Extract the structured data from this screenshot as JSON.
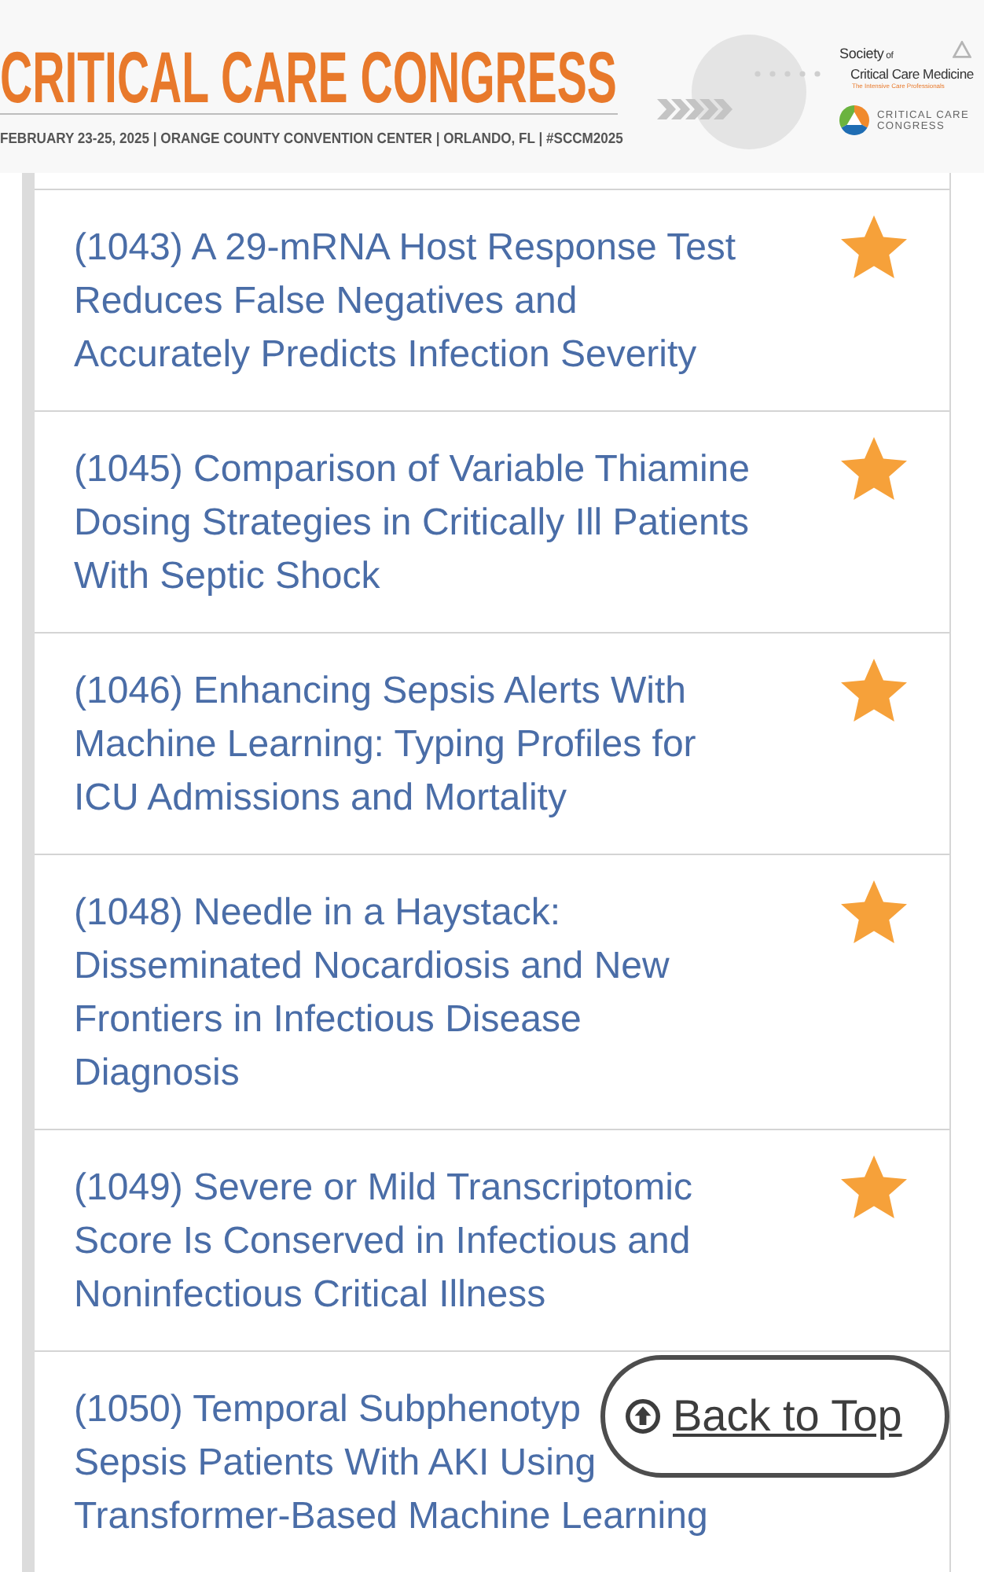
{
  "banner": {
    "title": "CRITICAL CARE CONGRESS",
    "subtitle": "FEBRUARY 23-25, 2025 | ORANGE COUNTY CONVENTION CENTER | ORLANDO, FL | #SCCM2025",
    "society_logo": {
      "line_1": "Society",
      "line_1_small": "of",
      "line_2": "Critical Care Medicine",
      "tagline": "The Intensive Care Professionals"
    },
    "congress_logo": {
      "line_1": "CRITICAL CARE",
      "line_2": "CONGRESS"
    }
  },
  "sessions": [
    {
      "title": "(1043) A 29-mRNA Host Response Test\nReduces False Negatives and\nAccurately Predicts Infection Severity",
      "starred": true
    },
    {
      "title": "(1045) Comparison of Variable Thiamine\nDosing Strategies in Critically Ill Patients\nWith Septic Shock",
      "starred": true
    },
    {
      "title": "(1046) Enhancing Sepsis Alerts With\nMachine Learning: Typing Profiles for\nICU Admissions and Mortality",
      "starred": true
    },
    {
      "title": "(1048) Needle in a Haystack:\nDisseminated Nocardiosis and New\nFrontiers in Infectious Disease\nDiagnosis",
      "starred": true
    },
    {
      "title": "(1049) Severe or Mild Transcriptomic\nScore Is Conserved in Infectious and\nNoninfectious Critical Illness",
      "starred": true
    },
    {
      "visible_title_lines": [
        "(1050) Temporal Subphenotyp",
        "Sepsis Patients With AKI Using",
        "Transformer-Based Machine Learning"
      ]
    }
  ],
  "back_to_top": {
    "label": "Back to Top"
  }
}
